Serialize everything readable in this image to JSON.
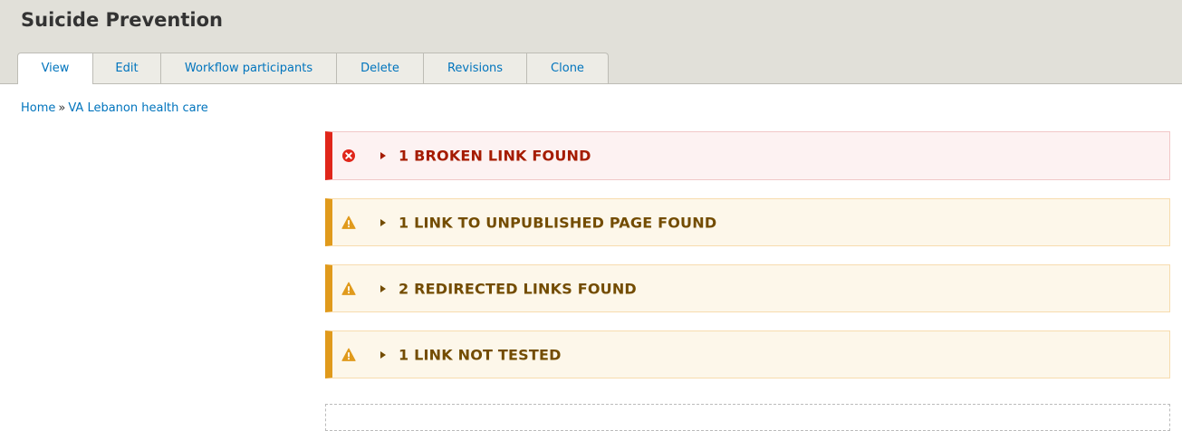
{
  "page": {
    "title": "Suicide Prevention"
  },
  "tabs": [
    {
      "label": "View",
      "active": true
    },
    {
      "label": "Edit",
      "active": false
    },
    {
      "label": "Workflow participants",
      "active": false
    },
    {
      "label": "Delete",
      "active": false
    },
    {
      "label": "Revisions",
      "active": false
    },
    {
      "label": "Clone",
      "active": false
    }
  ],
  "breadcrumb": {
    "home": "Home",
    "separator": "»",
    "current": "VA Lebanon health care"
  },
  "messages": [
    {
      "type": "error",
      "icon": "error-circle-icon",
      "text": "1 BROKEN LINK FOUND"
    },
    {
      "type": "warning",
      "icon": "warning-triangle-icon",
      "text": "1 LINK TO UNPUBLISHED PAGE FOUND"
    },
    {
      "type": "warning",
      "icon": "warning-triangle-icon",
      "text": "2 REDIRECTED LINKS FOUND"
    },
    {
      "type": "warning",
      "icon": "warning-triangle-icon",
      "text": "1 LINK NOT TESTED"
    }
  ],
  "colors": {
    "link": "#0074bd",
    "error_accent": "#e0261a",
    "warning_accent": "#e09a1c",
    "error_text": "#a51b00",
    "warning_text": "#734c00",
    "header_bg": "#e1e0d9"
  }
}
